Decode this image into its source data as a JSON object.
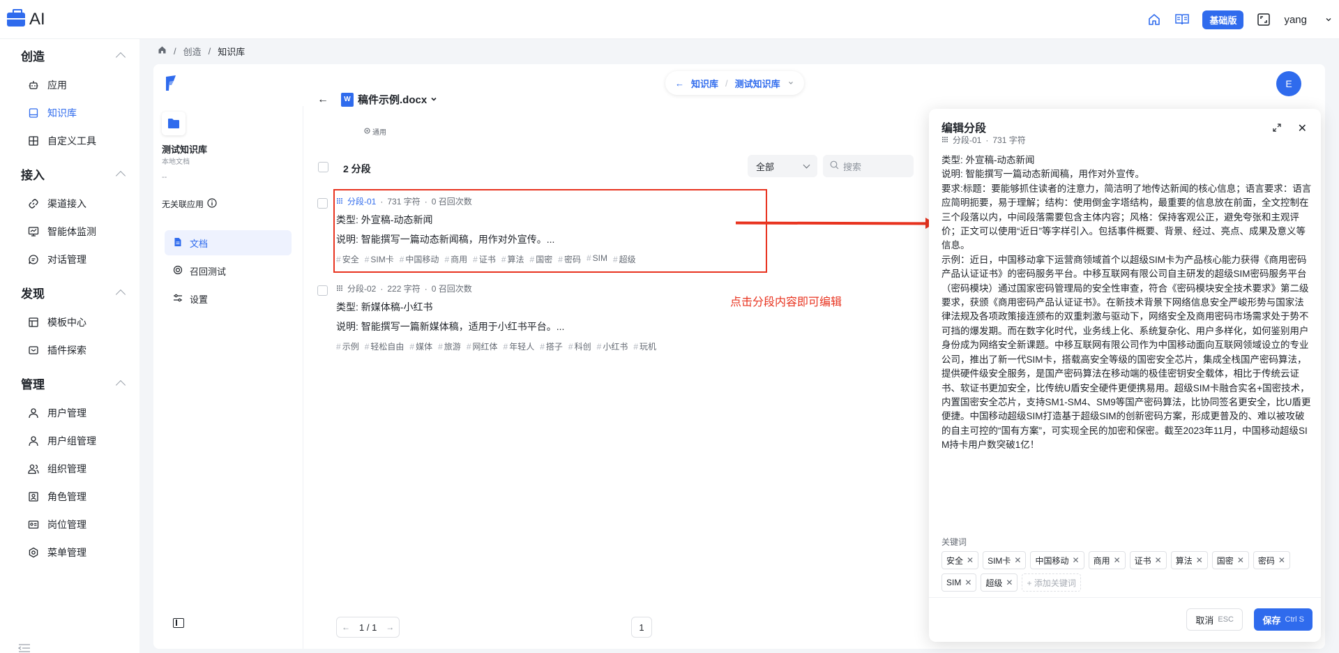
{
  "app": {
    "brand": "AI"
  },
  "topbar": {
    "plan_badge": "基础版",
    "username": "yang"
  },
  "nav": {
    "groups": [
      {
        "title": "创造",
        "items": [
          {
            "label": "应用"
          },
          {
            "label": "知识库",
            "active": true
          },
          {
            "label": "自定义工具"
          }
        ]
      },
      {
        "title": "接入",
        "items": [
          {
            "label": "渠道接入"
          },
          {
            "label": "智能体监测"
          },
          {
            "label": "对话管理"
          }
        ]
      },
      {
        "title": "发现",
        "items": [
          {
            "label": "模板中心"
          },
          {
            "label": "插件探索"
          }
        ]
      },
      {
        "title": "管理",
        "items": [
          {
            "label": "用户管理"
          },
          {
            "label": "用户组管理"
          },
          {
            "label": "组织管理"
          },
          {
            "label": "角色管理"
          },
          {
            "label": "岗位管理"
          },
          {
            "label": "菜单管理"
          }
        ]
      }
    ]
  },
  "breadcrumb": {
    "items": [
      "创造",
      "知识库"
    ]
  },
  "switcher": {
    "kb_link": "知识库",
    "current": "测试知识库"
  },
  "avatar_initial": "E",
  "kb": {
    "name": "测试知识库",
    "type": "本地文档",
    "dash": "--",
    "no_app": "无关联应用",
    "menu": [
      {
        "label": "文档",
        "active": true
      },
      {
        "label": "召回测试"
      },
      {
        "label": "设置"
      }
    ]
  },
  "doc": {
    "title": "稿件示例.docx",
    "sub": "通用",
    "icon_letter": "W",
    "segment_count": "2 分段",
    "filter": "全部",
    "search_placeholder": "搜索"
  },
  "segments": [
    {
      "id": "分段-01",
      "chars": "731 字符",
      "recalls": "0 召回次数",
      "type": "类型: 外宣稿-动态新闻",
      "desc": "说明: 智能撰写一篇动态新闻稿，用作对外宣传。...",
      "tags": [
        "安全",
        "SIM卡",
        "中国移动",
        "商用",
        "证书",
        "算法",
        "国密",
        "密码",
        "SIM",
        "超级"
      ]
    },
    {
      "id": "分段-02",
      "chars": "222 字符",
      "recalls": "0 召回次数",
      "type": "类型: 新媒体稿-小红书",
      "desc": "说明: 智能撰写一篇新媒体稿，适用于小红书平台。...",
      "tags": [
        "示例",
        "轻松自由",
        "媒体",
        "旅游",
        "网红体",
        "年轻人",
        "搭子",
        "科创",
        "小红书",
        "玩机"
      ]
    }
  ],
  "annotation": "点击分段内容即可编辑",
  "pagination": {
    "text": "1 / 1",
    "page": "1"
  },
  "edit_panel": {
    "title": "编辑分段",
    "seg_id": "分段-01",
    "chars": "731 字符",
    "content": "类型: 外宣稿-动态新闻\n说明: 智能撰写一篇动态新闻稿，用作对外宣传。\n要求:标题：要能够抓住读者的注意力，简洁明了地传达新闻的核心信息；语言要求：语言应简明扼要，易于理解；结构：使用倒金字塔结构，最重要的信息放在前面，全文控制在三个段落以内，中间段落需要包含主体内容；风格：保持客观公正，避免夸张和主观评价；正文可以使用“近日”等字样引入。包括事件概要、背景、经过、亮点、成果及意义等信息。\n示例：近日，中国移动拿下运营商领域首个以超级SIM卡为产品核心能力获得《商用密码产品认证证书》的密码服务平台。中移互联网有限公司自主研发的超级SIM密码服务平台（密码模块）通过国家密码管理局的安全性审查，符合《密码模块安全技术要求》第二级要求，获颁《商用密码产品认证证书》。在新技术背景下网络信息安全严峻形势与国家法律法规及各项政策接连颁布的双重刺激与驱动下，网络安全及商用密码市场需求处于势不可挡的爆发期。而在数字化时代，业务线上化、系统复杂化、用户多样化，如何鉴别用户身份成为网络安全新课题。中移互联网有限公司作为中国移动面向互联网领域设立的专业公司，推出了新一代SIM卡，搭载高安全等级的国密安全芯片，集成全栈国产密码算法，提供硬件级安全服务，是国产密码算法在移动端的极佳密钥安全载体，相比于传统云证书、软证书更加安全，比传统U盾安全硬件更便携易用。超级SIM卡融合实名+国密技术，内置国密安全芯片，支持SM1-SM4、SM9等国产密码算法，比协同签名更安全，比U盾更便捷。中国移动超级SIM打造基于超级SIM的创新密码方案，形成更普及的、难以被攻破的自主可控的“国有方案”，可实现全民的加密和保密。截至2023年11月，中国移动超级SIM持卡用户数突破1亿！",
    "keywords_label": "关键词",
    "keywords": [
      "安全",
      "SIM卡",
      "中国移动",
      "商用",
      "证书",
      "算法",
      "国密",
      "密码",
      "SIM",
      "超级"
    ],
    "add_keyword": "+ 添加关键词",
    "cancel_label": "取消",
    "cancel_kbd": "ESC",
    "save_label": "保存",
    "save_kbd": "Ctrl S"
  }
}
